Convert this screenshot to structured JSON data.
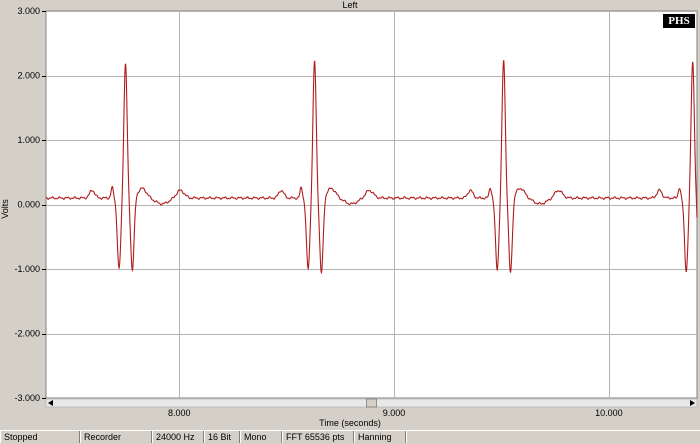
{
  "window": {
    "channel_title": "Left"
  },
  "chart_data": {
    "type": "line",
    "title": "Left",
    "xlabel": "Time (seconds)",
    "ylabel": "Volts",
    "xlim": [
      7.38,
      10.41
    ],
    "ylim": [
      -3.0,
      3.0
    ],
    "x_ticks": [
      "8.000",
      "9.000",
      "10.000"
    ],
    "x_tick_values": [
      8.0,
      9.0,
      10.0
    ],
    "y_ticks": [
      "3.000",
      "2.000",
      "1.000",
      "0.000",
      "-1.000",
      "-2.000",
      "-3.000"
    ],
    "y_tick_values": [
      3.0,
      2.0,
      1.0,
      0.0,
      -1.0,
      -2.0,
      -3.0
    ],
    "grid": true,
    "line_color": "#b01c1c",
    "baseline": 0.1,
    "beats": [
      {
        "r_peak_time": 7.75,
        "r_peak_volts": 2.13,
        "q_volts": -0.95,
        "s_volts": -0.97
      },
      {
        "r_peak_time": 8.63,
        "r_peak_volts": 2.17,
        "q_volts": -0.95,
        "s_volts": -1.02
      },
      {
        "r_peak_time": 9.51,
        "r_peak_volts": 2.19,
        "q_volts": -0.95,
        "s_volts": -1.02
      },
      {
        "r_peak_time": 10.39,
        "r_peak_volts": 2.17,
        "q_volts": -0.98,
        "s_volts": -1.02
      }
    ],
    "scroll_position": 0.5
  },
  "logo": {
    "text": "PHS"
  },
  "statusbar": {
    "state": "Stopped",
    "mode": "Recorder",
    "sample_rate": "24000 Hz",
    "bit_depth": "16 Bit",
    "channels": "Mono",
    "fft_size": "FFT 65536 pts",
    "window_fn": "Hanning"
  },
  "colors": {
    "plot_bg": "#ffffff",
    "grid": "#b4b4b4",
    "chrome": "#d4d0c8"
  }
}
